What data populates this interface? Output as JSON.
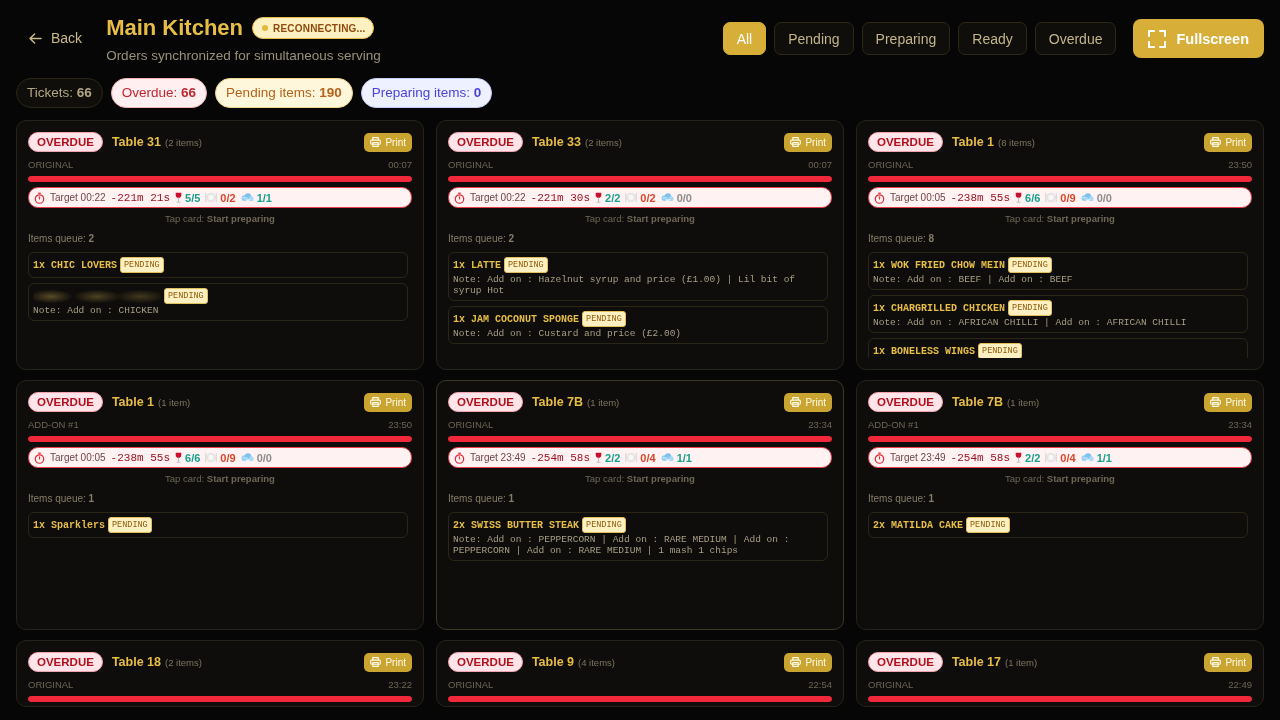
{
  "header": {
    "back_label": "Back",
    "title": "Main Kitchen",
    "connection_status": "RECONNECTING...",
    "subtitle": "Orders synchronized for simultaneous serving"
  },
  "filters": [
    {
      "label": "All",
      "selected": true
    },
    {
      "label": "Pending",
      "selected": false
    },
    {
      "label": "Preparing",
      "selected": false
    },
    {
      "label": "Ready",
      "selected": false
    },
    {
      "label": "Overdue",
      "selected": false
    }
  ],
  "fullscreen_button": "Fullscreen",
  "stats": [
    {
      "kind": "neutral",
      "text": "Tickets: **66**"
    },
    {
      "kind": "danger",
      "text": "Overdue: **66**"
    },
    {
      "kind": "warning",
      "text": "Pending items: **190**"
    },
    {
      "kind": "info",
      "text": "Preparing items: **0**"
    }
  ],
  "tickets": [
    {
      "status": "OVERDUE",
      "table": "Table 31",
      "item_count": "(2 items)",
      "print_label": "Print",
      "round": "ORIGINAL",
      "time": "00:07",
      "level": 1,
      "highlighted": false,
      "target": {
        "label": "Target 00:22",
        "delta": "-221m 21s",
        "counts": [
          {
            "kind": "drinks",
            "text": "5/5",
            "color": "#17a08b"
          },
          {
            "kind": "food",
            "text": "0/2",
            "color": "#d9472b"
          },
          {
            "kind": "other",
            "text": "1/1",
            "color": "#17a08b"
          }
        ]
      },
      "hint": "Tap card: **Start preparing**",
      "queue": "Items queue: **2**",
      "items": [
        {
          "name": "1x CHIC LOVERS",
          "blurred": false,
          "status": "PENDING"
        },
        {
          "blurred": true,
          "status": "PENDING",
          "note": "Note: Add on : CHICKEN"
        }
      ]
    },
    {
      "status": "OVERDUE",
      "table": "Table 33",
      "item_count": "(2 items)",
      "print_label": "Print",
      "round": "ORIGINAL",
      "time": "00:07",
      "level": 1,
      "highlighted": false,
      "target": {
        "label": "Target 00:22",
        "delta": "-221m 30s",
        "counts": [
          {
            "kind": "drinks",
            "text": "2/2",
            "color": "#17a08b"
          },
          {
            "kind": "food",
            "text": "0/2",
            "color": "#d9472b"
          },
          {
            "kind": "other",
            "text": "0/0",
            "color": "#8d8d8d"
          }
        ]
      },
      "hint": "Tap card: **Start preparing**",
      "queue": "Items queue: **2**",
      "items": [
        {
          "name": "1x LATTE",
          "blurred": false,
          "status": "PENDING",
          "note": "Note: Add on : Hazelnut syrup and price (£1.00) | Lil bit of syrup Hot"
        },
        {
          "name": "1x JAM COCONUT SPONGE",
          "blurred": false,
          "status": "PENDING",
          "note": "Note: Add on : Custard and price (£2.00)"
        }
      ]
    },
    {
      "status": "OVERDUE",
      "table": "Table 1",
      "item_count": "(8 items)",
      "print_label": "Print",
      "round": "ORIGINAL",
      "time": "23:50",
      "level": 1,
      "highlighted": false,
      "target": {
        "label": "Target 00:05",
        "delta": "-238m 55s",
        "counts": [
          {
            "kind": "drinks",
            "text": "6/6",
            "color": "#17a08b"
          },
          {
            "kind": "food",
            "text": "0/9",
            "color": "#d9472b"
          },
          {
            "kind": "other",
            "text": "0/0",
            "color": "#8d8d8d"
          }
        ]
      },
      "hint": "Tap card: **Start preparing**",
      "queue": "Items queue: **8**",
      "items": [
        {
          "name": "1x WOK FRIED CHOW MEIN",
          "blurred": false,
          "status": "PENDING",
          "note": "Note: Add on : BEEF | Add on : BEEF"
        },
        {
          "name": "1x CHARGRILLED CHICKEN",
          "blurred": false,
          "status": "PENDING",
          "note": "Note: Add on : AFRICAN CHILLI | Add on : AFRICAN CHILLI"
        },
        {
          "name": "1x BONELESS WINGS",
          "blurred": false,
          "status": "PENDING"
        }
      ]
    },
    {
      "status": "OVERDUE",
      "table": "Table 1",
      "item_count": "(1 item)",
      "print_label": "Print",
      "round": "ADD-ON #1",
      "time": "23:50",
      "level": 1,
      "highlighted": false,
      "target": {
        "label": "Target 00:05",
        "delta": "-238m 55s",
        "counts": [
          {
            "kind": "drinks",
            "text": "6/6",
            "color": "#17a08b"
          },
          {
            "kind": "food",
            "text": "0/9",
            "color": "#d9472b"
          },
          {
            "kind": "other",
            "text": "0/0",
            "color": "#8d8d8d"
          }
        ]
      },
      "hint": "Tap card: **Start preparing**",
      "queue": "Items queue: **1**",
      "items": [
        {
          "name": "1x Sparklers",
          "blurred": false,
          "status": "PENDING"
        }
      ]
    },
    {
      "status": "OVERDUE",
      "table": "Table 7B",
      "item_count": "(1 item)",
      "print_label": "Print",
      "round": "ORIGINAL",
      "time": "23:34",
      "level": 1,
      "highlighted": true,
      "target": {
        "label": "Target 23:49",
        "delta": "-254m 58s",
        "counts": [
          {
            "kind": "drinks",
            "text": "2/2",
            "color": "#17a08b"
          },
          {
            "kind": "food",
            "text": "0/4",
            "color": "#d9472b"
          },
          {
            "kind": "other",
            "text": "1/1",
            "color": "#17a08b"
          }
        ]
      },
      "hint": "Tap card: **Start preparing**",
      "queue": "Items queue: **1**",
      "items": [
        {
          "name": "2x SWISS BUTTER STEAK",
          "blurred": false,
          "status": "PENDING",
          "note": "Note: Add on : PEPPERCORN | Add on : RARE MEDIUM | Add on : PEPPERCORN | Add on : RARE MEDIUM | 1 mash 1 chips"
        }
      ]
    },
    {
      "status": "OVERDUE",
      "table": "Table 7B",
      "item_count": "(1 item)",
      "print_label": "Print",
      "round": "ADD-ON #1",
      "time": "23:34",
      "level": 1,
      "highlighted": false,
      "target": {
        "label": "Target 23:49",
        "delta": "-254m 58s",
        "counts": [
          {
            "kind": "drinks",
            "text": "2/2",
            "color": "#17a08b"
          },
          {
            "kind": "food",
            "text": "0/4",
            "color": "#d9472b"
          },
          {
            "kind": "other",
            "text": "1/1",
            "color": "#17a08b"
          }
        ]
      },
      "hint": "Tap card: **Start preparing**",
      "queue": "Items queue: **1**",
      "items": [
        {
          "name": "2x MATILDA CAKE",
          "blurred": false,
          "status": "PENDING"
        }
      ]
    },
    {
      "status": "OVERDUE",
      "table": "Table 18",
      "item_count": "(2 items)",
      "print_label": "Print",
      "round": "ORIGINAL",
      "time": "23:22",
      "level": 1,
      "highlighted": false
    },
    {
      "status": "OVERDUE",
      "table": "Table 9",
      "item_count": "(4 items)",
      "print_label": "Print",
      "round": "ORIGINAL",
      "time": "22:54",
      "level": 1,
      "highlighted": false
    },
    {
      "status": "OVERDUE",
      "table": "Table 17",
      "item_count": "(1 item)",
      "print_label": "Print",
      "round": "ORIGINAL",
      "time": "22:49",
      "level": 1,
      "highlighted": false
    }
  ]
}
